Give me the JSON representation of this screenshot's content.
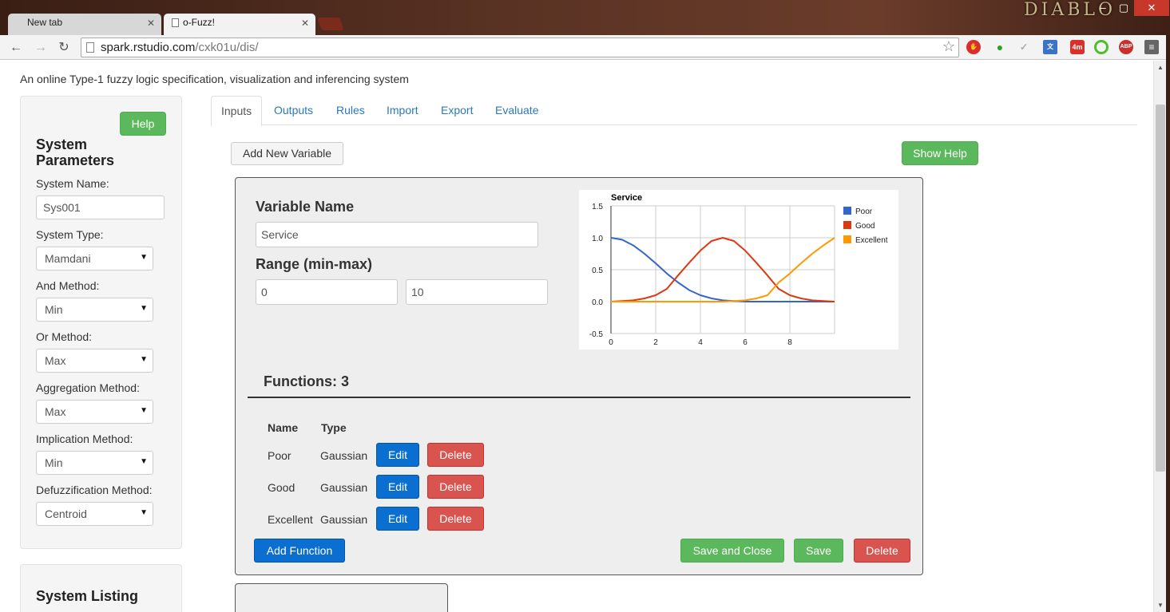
{
  "browser": {
    "tabs": [
      {
        "label": "New tab"
      },
      {
        "label": "o-Fuzz!"
      }
    ],
    "url_host": "spark.rstudio.com",
    "url_path": "/cxk01u/dis/",
    "extensions": [
      "4m",
      "ABP"
    ],
    "theme_logo": "DIABLO"
  },
  "page": {
    "subtitle": "An online Type-1 fuzzy logic specification, visualization and inferencing system"
  },
  "sidebar": {
    "help_label": "Help",
    "title": "System Parameters",
    "system_name_label": "System Name:",
    "system_name_value": "Sys001",
    "system_type_label": "System Type:",
    "system_type_value": "Mamdani",
    "and_label": "And Method:",
    "and_value": "Min",
    "or_label": "Or Method:",
    "or_value": "Max",
    "agg_label": "Aggregation Method:",
    "agg_value": "Max",
    "impl_label": "Implication Method:",
    "impl_value": "Min",
    "defuzz_label": "Defuzzification Method:",
    "defuzz_value": "Centroid",
    "listing_title": "System Listing"
  },
  "nav_tabs": [
    "Inputs",
    "Outputs",
    "Rules",
    "Import",
    "Export",
    "Evaluate"
  ],
  "toolbar": {
    "add_variable": "Add New Variable",
    "show_help": "Show Help"
  },
  "variable": {
    "name_label": "Variable Name",
    "name_value": "Service",
    "range_label": "Range (min-max)",
    "range_min": "0",
    "range_max": "10",
    "functions_title": "Functions: 3",
    "col_name": "Name",
    "col_type": "Type",
    "functions": [
      {
        "name": "Poor",
        "type": "Gaussian"
      },
      {
        "name": "Good",
        "type": "Gaussian"
      },
      {
        "name": "Excellent",
        "type": "Gaussian"
      }
    ],
    "edit_label": "Edit",
    "delete_label": "Delete",
    "add_function": "Add Function",
    "save_close": "Save and Close",
    "save": "Save",
    "delete": "Delete"
  },
  "chart_data": {
    "type": "line",
    "title": "Service",
    "xlim": [
      0,
      10
    ],
    "ylim": [
      -0.5,
      1.5
    ],
    "xticks": [
      0,
      2,
      4,
      6,
      8
    ],
    "yticks": [
      1.5,
      1.0,
      0.5,
      0.0,
      -0.5
    ],
    "ytick_labels": [
      "1.5",
      "1.0",
      "0.5",
      "0.0",
      "-0.5"
    ],
    "legend_position": "right",
    "grid": true,
    "x": [
      0,
      0.5,
      1,
      1.5,
      2,
      2.5,
      3,
      3.5,
      4,
      4.5,
      5,
      5.5,
      6,
      6.5,
      7,
      7.5,
      8,
      8.5,
      9,
      9.5,
      10
    ],
    "series": [
      {
        "name": "Poor",
        "color": "#3366cc",
        "values": [
          1.0,
          0.97,
          0.88,
          0.75,
          0.6,
          0.44,
          0.3,
          0.18,
          0.1,
          0.05,
          0.02,
          0.01,
          0.0,
          0.0,
          0.0,
          0.0,
          0.0,
          0.0,
          0.0,
          0.0,
          0.0
        ]
      },
      {
        "name": "Good",
        "color": "#dc3912",
        "values": [
          0.0,
          0.01,
          0.02,
          0.05,
          0.1,
          0.2,
          0.41,
          0.61,
          0.8,
          0.95,
          1.0,
          0.95,
          0.8,
          0.61,
          0.41,
          0.2,
          0.1,
          0.05,
          0.02,
          0.01,
          0.0
        ]
      },
      {
        "name": "Excellent",
        "color": "#ff9900",
        "values": [
          0.0,
          0.0,
          0.0,
          0.0,
          0.0,
          0.0,
          0.0,
          0.0,
          0.0,
          0.0,
          0.0,
          0.01,
          0.02,
          0.05,
          0.1,
          0.3,
          0.44,
          0.6,
          0.75,
          0.88,
          1.0
        ]
      }
    ]
  }
}
